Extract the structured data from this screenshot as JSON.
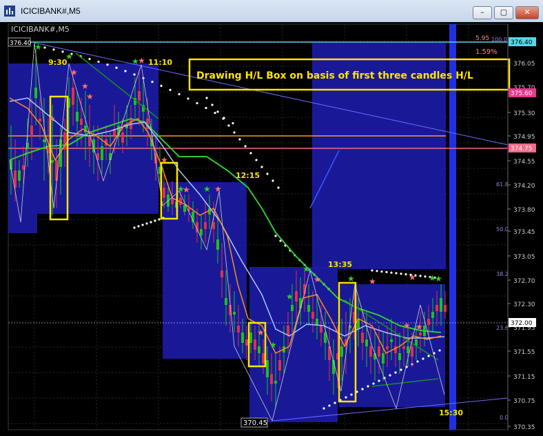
{
  "window": {
    "title": "ICICIBANK#,M5",
    "minimize": "–",
    "maximize": "▢",
    "close": "✕"
  },
  "chart": {
    "symbol_label": "ICICIBANK#,M5",
    "annotation": "Drawing H/L Box on basis of first three candles H/L",
    "time_labels": [
      "9:30",
      "11:10",
      "12:15",
      "13:35",
      "15:30"
    ],
    "high_label": "376.40",
    "low_label": "370.45",
    "fib_labels": [
      "5.95",
      "1.59%",
      "100.0",
      "61.8",
      "50.0",
      "38.2",
      "23.6",
      "0.0"
    ],
    "price_ticks": [
      "376.05",
      "375.70",
      "375.30",
      "374.95",
      "374.55",
      "374.20",
      "373.80",
      "373.45",
      "373.05",
      "372.70",
      "372.30",
      "371.95",
      "371.55",
      "371.15",
      "370.75",
      "370.35"
    ],
    "price_badges": [
      {
        "text": "376.40",
        "color": "#57d6e6",
        "textcolor": "#000000"
      },
      {
        "text": "375.60",
        "color": "#e6398f",
        "textcolor": "#ffffff"
      },
      {
        "text": "374.75",
        "color": "#f26b8a",
        "textcolor": "#ffffff"
      },
      {
        "text": "372.00",
        "color": "#ffffff",
        "textcolor": "#000000"
      }
    ]
  },
  "colors": {
    "up": "#18c418",
    "down": "#e0304a",
    "box": "#1c1ca8",
    "highlight": "#ffe600",
    "fast_ma": "#ff8a1f",
    "slow_ma": "#2ecc2e",
    "mid_ma": "#a8c8ff"
  }
}
